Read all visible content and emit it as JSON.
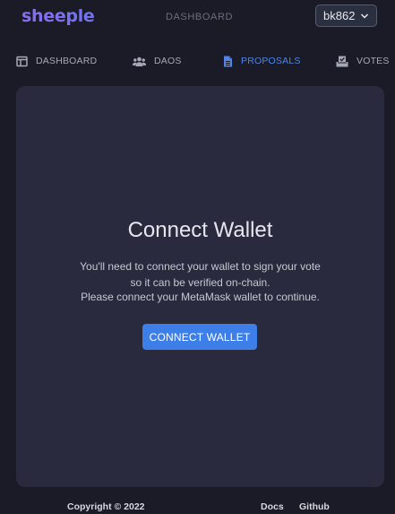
{
  "header": {
    "logo": "sheeple",
    "title": "DASHBOARD",
    "account": "bk862"
  },
  "nav": {
    "items": [
      {
        "label": "DASHBOARD",
        "icon": "table-icon",
        "active": false
      },
      {
        "label": "DAOS",
        "icon": "users-icon",
        "active": false
      },
      {
        "label": "PROPOSALS",
        "icon": "document-icon",
        "active": true
      },
      {
        "label": "VOTES",
        "icon": "ballot-box-icon",
        "active": false
      }
    ]
  },
  "main": {
    "title": "Connect Wallet",
    "line1": "You'll need to connect your wallet to sign your vote",
    "line2": "so it can be verified on-chain.",
    "line3": "Please connect your MetaMask wallet to continue.",
    "button": "CONNECT WALLET"
  },
  "footer": {
    "copyright": "Copyright © 2022",
    "docs": "Docs",
    "github": "Github"
  },
  "colors": {
    "background": "#1b1b27",
    "card": "#292a3d",
    "accent": "#3e7ee8",
    "logo": "#7d6cf2",
    "active_nav": "#4b86e8"
  }
}
